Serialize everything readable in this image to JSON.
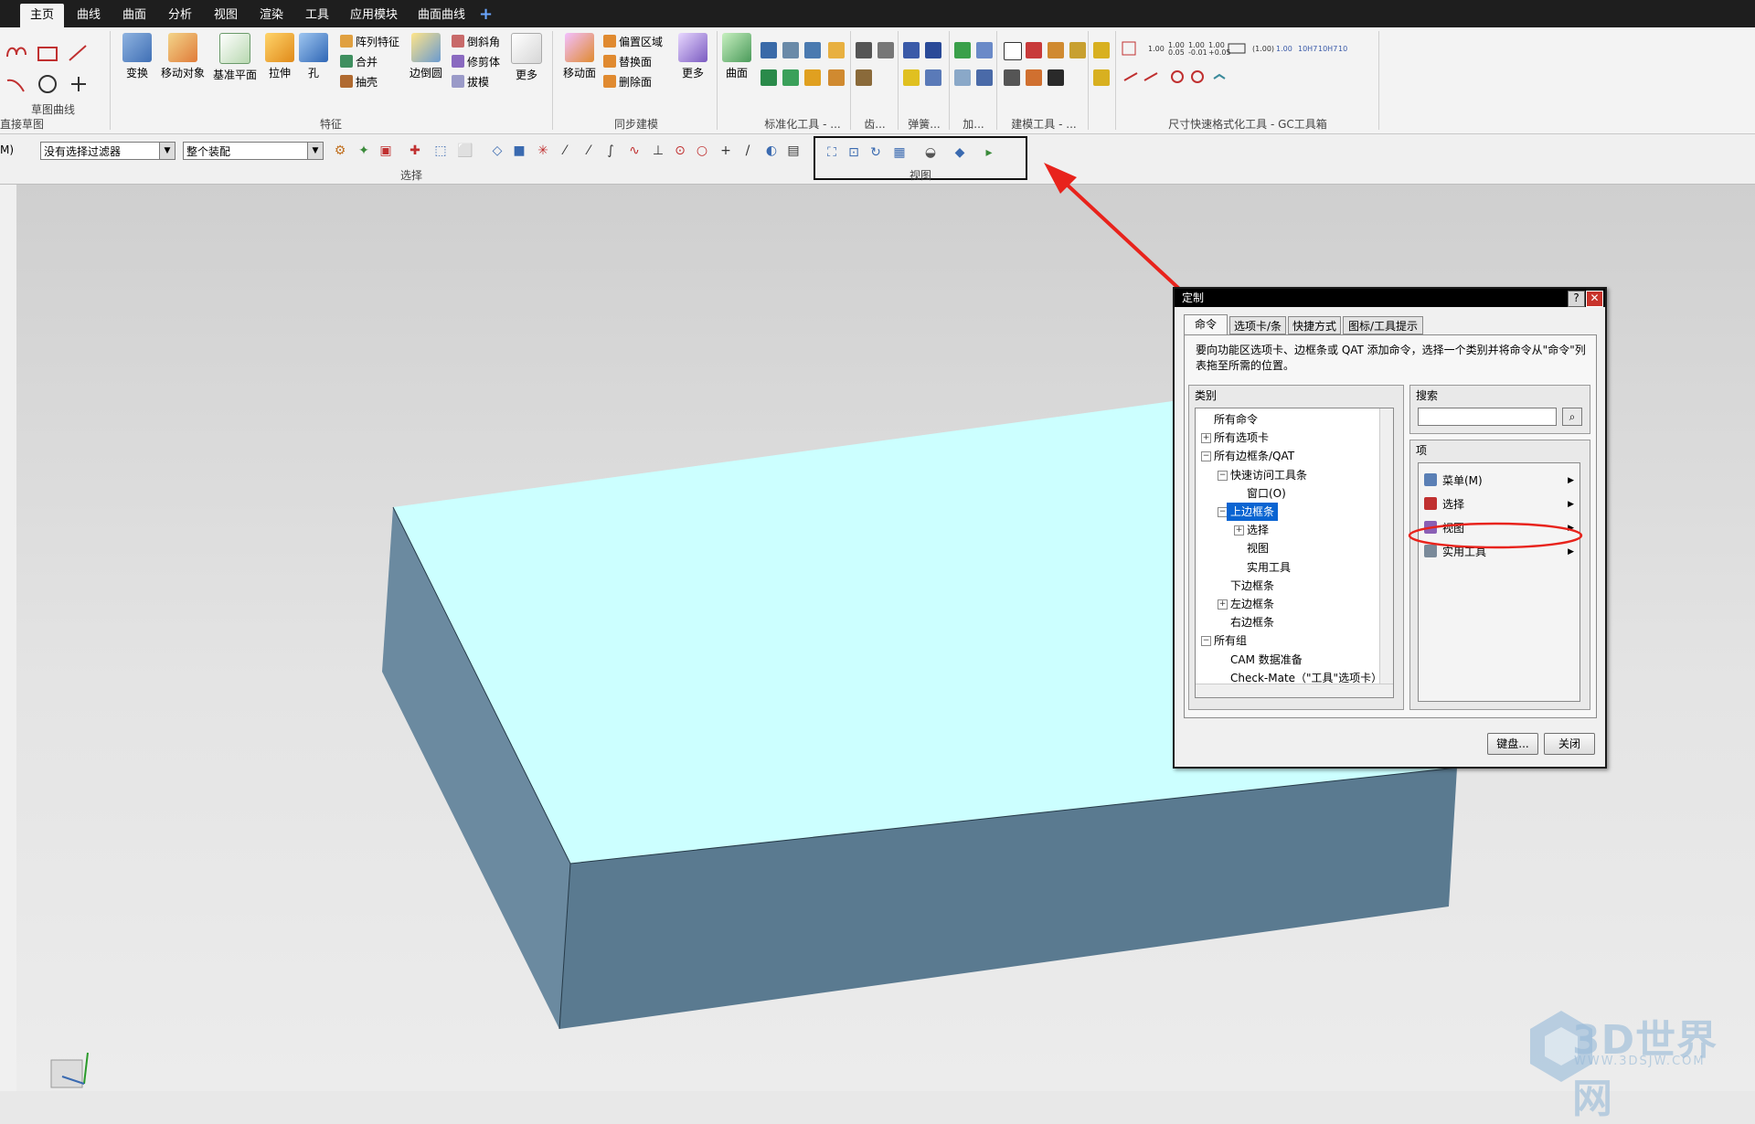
{
  "tabs": [
    {
      "label": "主页",
      "active": true
    },
    {
      "label": "曲线"
    },
    {
      "label": "曲面"
    },
    {
      "label": "分析"
    },
    {
      "label": "视图"
    },
    {
      "label": "渲染"
    },
    {
      "label": "工具"
    },
    {
      "label": "应用模块"
    },
    {
      "label": "曲面曲线"
    }
  ],
  "tab_add": "+",
  "ribbon": {
    "groups": {
      "sketch_curve": "草图曲线",
      "direct_sketch": "直接草图",
      "feature": "特征",
      "sync_modeling": "同步建模",
      "std_tools": "标准化工具 - ...",
      "gear": "齿...",
      "spring": "弹簧...",
      "add": "加...",
      "modeling_tools": "建模工具 - ...",
      "gc": "尺寸快速格式化工具 - GC工具箱"
    },
    "buttons": {
      "transform": "变换",
      "move_object": "移动对象",
      "datum_plane": "基准平面",
      "extrude": "拉伸",
      "hole": "孔",
      "pattern_feature": "阵列特征",
      "unite": "合并",
      "shell": "抽壳",
      "edge_blend": "边倒圆",
      "chamfer": "倒斜角",
      "trim_body": "修剪体",
      "draft": "拔模",
      "more1": "更多",
      "move_face": "移动面",
      "offset_region": "偏置区域",
      "replace_face": "替换面",
      "delete_face": "删除面",
      "more2": "更多",
      "surface": "曲面"
    }
  },
  "selection_bar": {
    "menu_label": "M)",
    "filter_value": "没有选择过滤器",
    "scope_value": "整个装配",
    "group_select": "选择",
    "group_view": "视图"
  },
  "dialog": {
    "title": "定制",
    "help": "?",
    "close": "✕",
    "tabs": [
      "命令",
      "选项卡/条",
      "快捷方式",
      "图标/工具提示"
    ],
    "instruction": "要向功能区选项卡、边框条或 QAT 添加命令，选择一个类别并将命令从\"命令\"列表拖至所需的位置。",
    "category_label": "类别",
    "tree": [
      {
        "label": "所有命令",
        "level": 0,
        "exp": ""
      },
      {
        "label": "所有选项卡",
        "level": 0,
        "exp": "+"
      },
      {
        "label": "所有边框条/QAT",
        "level": 0,
        "exp": "−"
      },
      {
        "label": "快速访问工具条",
        "level": 1,
        "exp": "−"
      },
      {
        "label": "窗口(O)",
        "level": 2,
        "exp": ""
      },
      {
        "label": "上边框条",
        "level": 1,
        "exp": "−",
        "selected": true
      },
      {
        "label": "选择",
        "level": 2,
        "exp": "+"
      },
      {
        "label": "视图",
        "level": 2,
        "exp": ""
      },
      {
        "label": "实用工具",
        "level": 2,
        "exp": ""
      },
      {
        "label": "下边框条",
        "level": 1,
        "exp": ""
      },
      {
        "label": "左边框条",
        "level": 1,
        "exp": "+"
      },
      {
        "label": "右边框条",
        "level": 1,
        "exp": ""
      },
      {
        "label": "所有组",
        "level": 0,
        "exp": "−"
      },
      {
        "label": "CAM 数据准备",
        "level": 1,
        "exp": ""
      },
      {
        "label": "Check-Mate（\"工具\"选项卡）",
        "level": 1,
        "exp": ""
      }
    ],
    "search_label": "搜索",
    "search_value": "",
    "items_label": "项",
    "items": [
      {
        "label": "菜单(M)",
        "icon_color": "#5a7fb5"
      },
      {
        "label": "选择",
        "icon_color": "#c03030"
      },
      {
        "label": "视图",
        "icon_color": "#8a5fb5",
        "circled": true
      },
      {
        "label": "实用工具",
        "icon_color": "#7a8a9a"
      }
    ],
    "keyboard_button": "键盘...",
    "close_button": "关闭"
  },
  "watermark": {
    "text": "3D世界网",
    "sub": "WWW.3DSJW.COM"
  },
  "colors": {
    "top_face": "#ccffff",
    "side_face_left": "#6b8aa0",
    "side_face_front": "#5a7a90",
    "annotation_red": "#e8231c",
    "selection_blue": "#0a64d2"
  }
}
